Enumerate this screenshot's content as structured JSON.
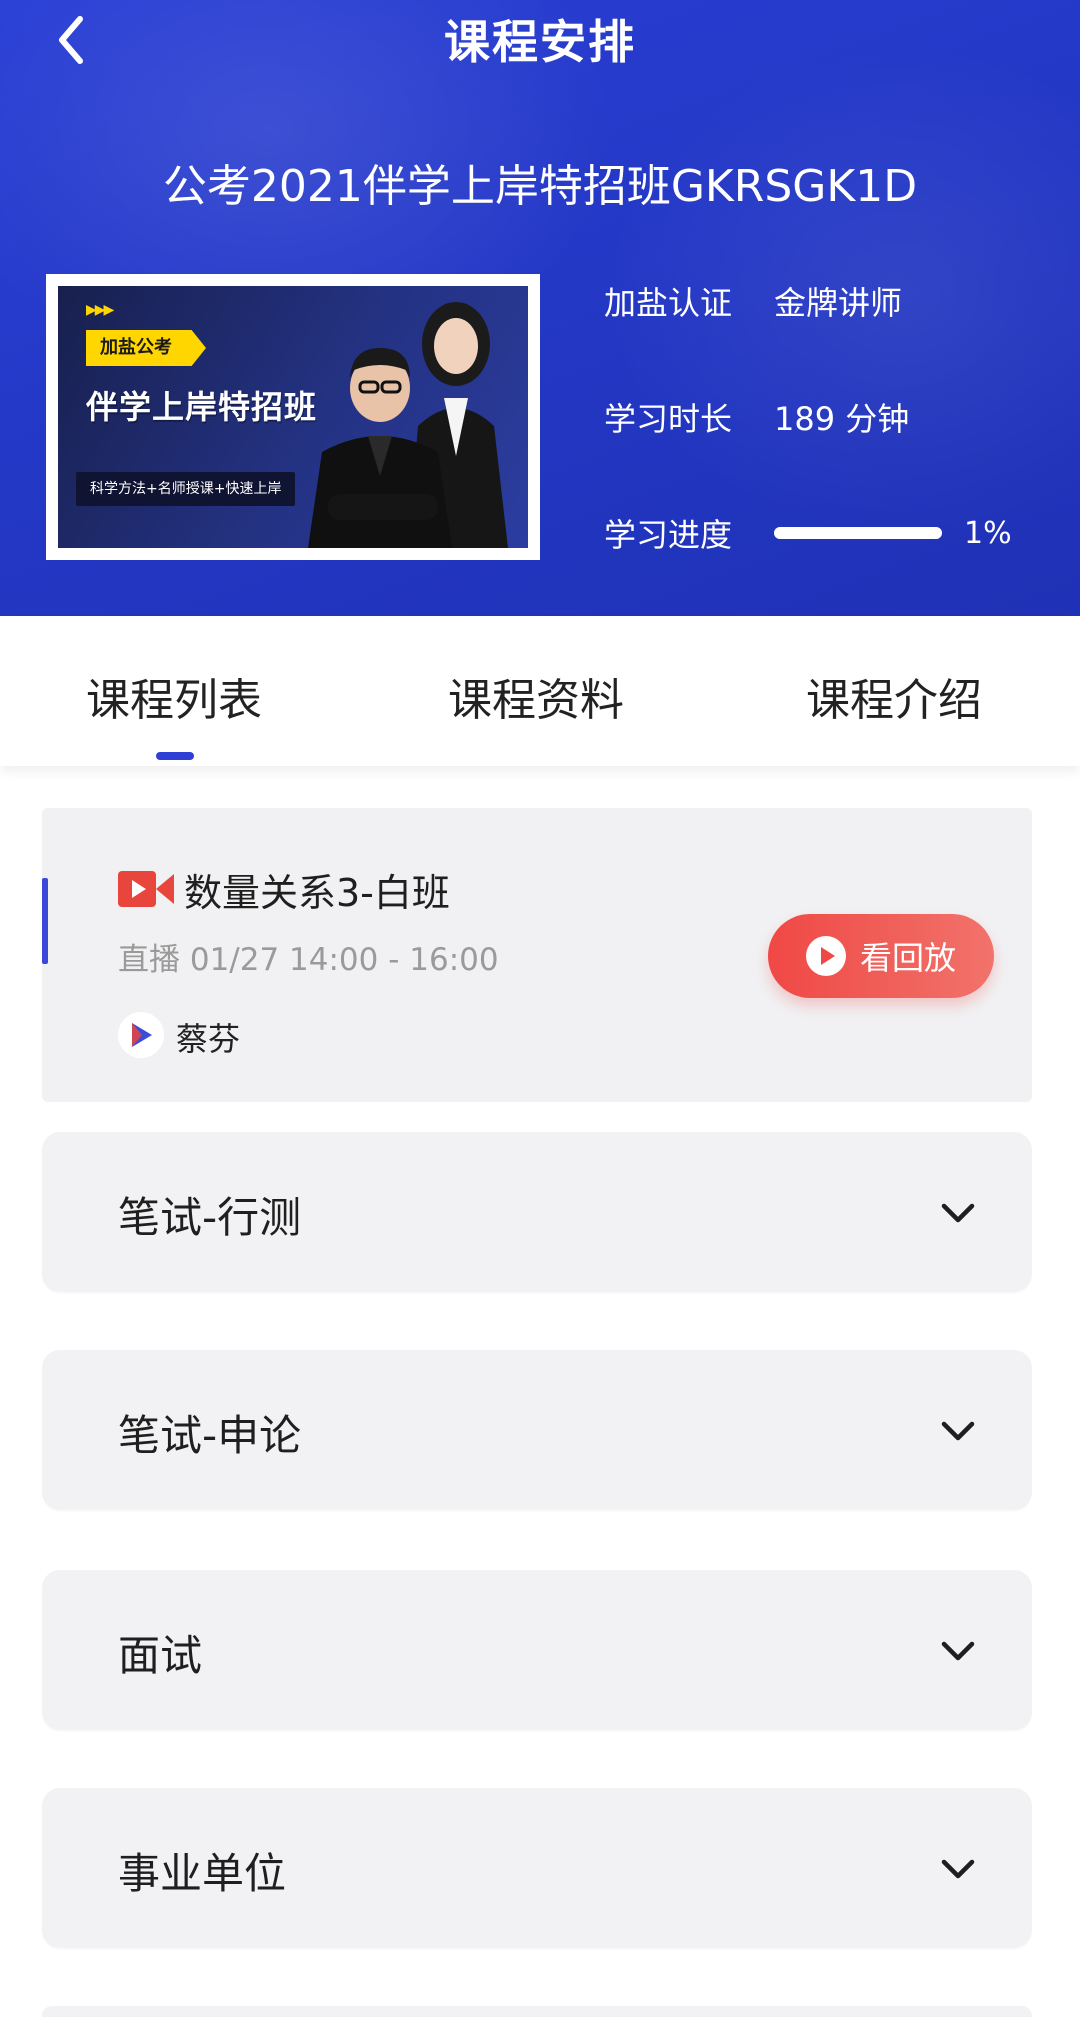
{
  "header": {
    "title": "课程安排",
    "course_title": "公考2021伴学上岸特招班GKRSGK1D",
    "cover": {
      "tag": "加盐公考",
      "headline": "伴学上岸特招班",
      "slogan": "科学方法+名师授课+快速上岸",
      "arrows": "▶▶▶"
    },
    "info": {
      "cert_label": "加盐认证",
      "cert_value": "金牌讲师",
      "duration_label": "学习时长",
      "duration_value": "189 分钟",
      "progress_label": "学习进度",
      "progress_value": "1%",
      "progress_fraction": 0.01
    }
  },
  "tabs": [
    "课程列表",
    "课程资料",
    "课程介绍"
  ],
  "active_tab": 0,
  "live": {
    "title": "数量关系3-白班",
    "time": "直播 01/27 14:00 - 16:00",
    "teacher": "蔡芬",
    "replay_label": "看回放"
  },
  "sections": [
    "笔试-行测",
    "笔试-申论",
    "面试",
    "事业单位"
  ],
  "colors": {
    "header_blue": "#2337c4",
    "accent_blue": "#2e3fd6",
    "replay_red": "#f04845",
    "card_bg": "#f2f2f4"
  }
}
